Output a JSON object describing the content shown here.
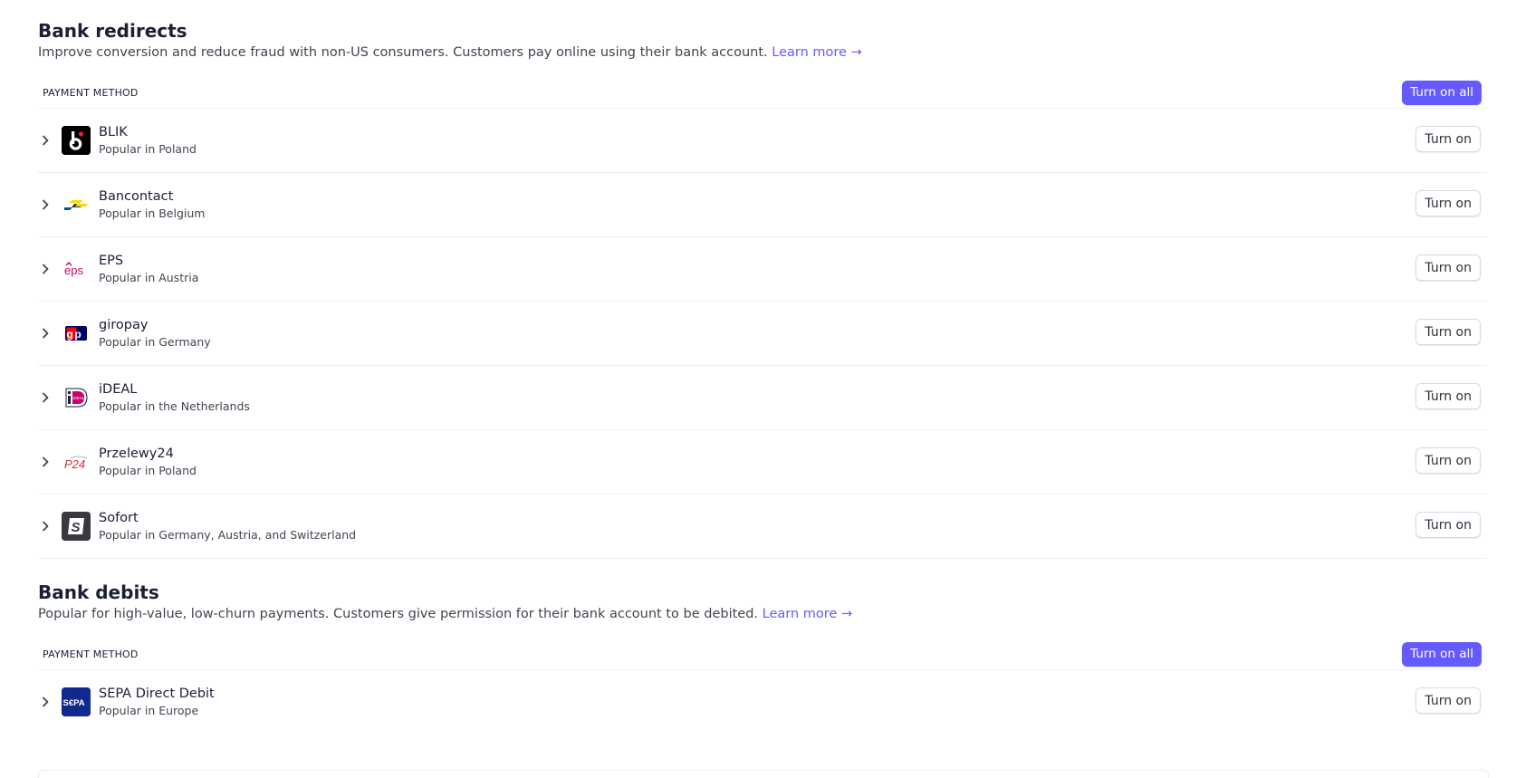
{
  "bank_redirects": {
    "title": "Bank redirects",
    "description": "Improve conversion and reduce fraud with non-US consumers. Customers pay online using their bank account.",
    "learn_more": "Learn more →",
    "column_header": "PAYMENT METHOD",
    "turn_on_all": "Turn on all",
    "methods": [
      {
        "name": "BLIK",
        "subtitle": "Popular in Poland",
        "icon": "blik-logo-icon",
        "button": "Turn on"
      },
      {
        "name": "Bancontact",
        "subtitle": "Popular in Belgium",
        "icon": "bancontact-logo-icon",
        "button": "Turn on"
      },
      {
        "name": "EPS",
        "subtitle": "Popular in Austria",
        "icon": "eps-logo-icon",
        "button": "Turn on"
      },
      {
        "name": "giropay",
        "subtitle": "Popular in Germany",
        "icon": "giropay-logo-icon",
        "button": "Turn on"
      },
      {
        "name": "iDEAL",
        "subtitle": "Popular in the Netherlands",
        "icon": "ideal-logo-icon",
        "button": "Turn on"
      },
      {
        "name": "Przelewy24",
        "subtitle": "Popular in Poland",
        "icon": "przelewy24-logo-icon",
        "button": "Turn on"
      },
      {
        "name": "Sofort",
        "subtitle": "Popular in Germany, Austria, and Switzerland",
        "icon": "sofort-logo-icon",
        "button": "Turn on"
      }
    ]
  },
  "bank_debits": {
    "title": "Bank debits",
    "description": "Popular for high-value, low-churn payments. Customers give permission for their bank account to be debited.",
    "learn_more": "Learn more →",
    "column_header": "PAYMENT METHOD",
    "turn_on_all": "Turn on all",
    "methods": [
      {
        "name": "SEPA Direct Debit",
        "subtitle": "Popular in Europe",
        "icon": "sepa-logo-icon",
        "button": "Turn on"
      }
    ]
  },
  "logo_text": {
    "eps": "eps",
    "giropay": "gp",
    "ideal": "iDEAL",
    "p24": "P24",
    "sofort": "S",
    "sepa": "S€PA"
  },
  "colors": {
    "accent": "#635bff",
    "text": "#1a1f36",
    "muted": "#414552",
    "border": "#ebeef1"
  }
}
